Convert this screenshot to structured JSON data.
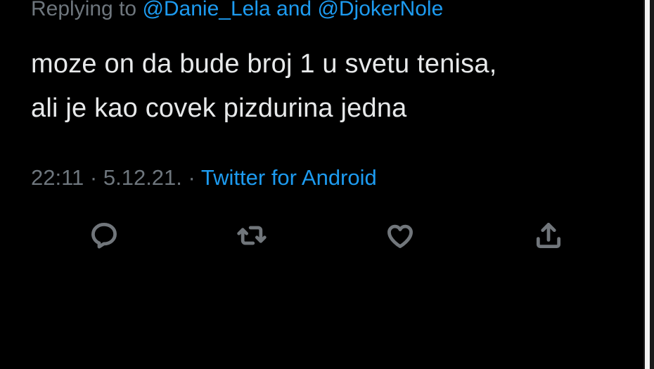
{
  "reply": {
    "prefix": "Replying to",
    "mention_1": "@Danie_Lela",
    "conjunction": "and",
    "mention_2": "@DjokerNole"
  },
  "tweet": {
    "line_1": "moze on da bude broj 1 u svetu tenisa,",
    "line_2": "ali je kao covek pizdurina jedna"
  },
  "meta": {
    "time": "22:11",
    "separator": "·",
    "date": "5.12.21.",
    "source": "Twitter for Android"
  },
  "actions": {
    "reply_icon": "reply-icon",
    "retweet_icon": "retweet-icon",
    "like_icon": "heart-icon",
    "share_icon": "share-icon"
  },
  "colors": {
    "background": "#000000",
    "text": "#e7e9ea",
    "muted": "#6e767d",
    "link": "#1d9bf0"
  }
}
